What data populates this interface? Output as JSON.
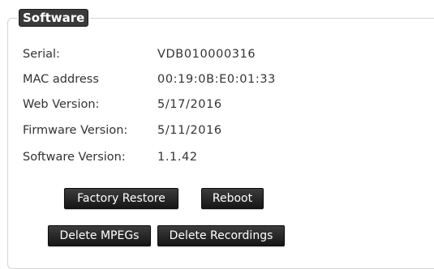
{
  "section": {
    "title": "Software"
  },
  "fields": [
    {
      "label": "Serial:",
      "value": "VDB010000316"
    },
    {
      "label": "MAC address",
      "value": "00:19:0B:E0:01:33"
    },
    {
      "label": "Web Version:",
      "value": "5/17/2016"
    },
    {
      "label": "Firmware Version:",
      "value": "5/11/2016"
    },
    {
      "label": "Software Version:",
      "value": "1.1.42"
    }
  ],
  "buttons": {
    "factory_restore": "Factory Restore",
    "reboot": "Reboot",
    "delete_mpegs": "Delete MPEGs",
    "delete_recordings": "Delete Recordings"
  },
  "colors": {
    "button_bg": "#1f1f1f",
    "legend_bg": "#3a3a3a",
    "text": "#333333",
    "border": "#d4d4d4"
  }
}
